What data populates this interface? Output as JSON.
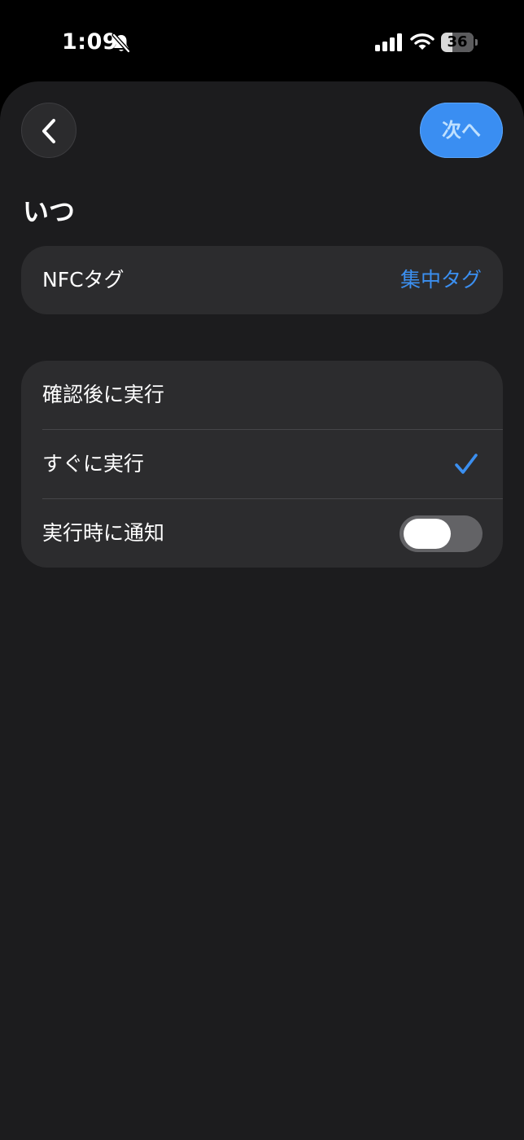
{
  "status_bar": {
    "time": "1:09",
    "battery_level": "36",
    "battery_fraction": 0.36,
    "icons": [
      "bell-slash-icon",
      "cellular-signal-icon",
      "wifi-icon",
      "battery-icon"
    ]
  },
  "header": {
    "back_icon": "chevron-left-icon",
    "next_label": "次へ"
  },
  "section": {
    "title": "いつ"
  },
  "trigger": {
    "label": "NFCタグ",
    "value": "集中タグ"
  },
  "options": {
    "items": [
      {
        "label": "確認後に実行",
        "selected": false
      },
      {
        "label": "すぐに実行",
        "selected": true
      },
      {
        "label": "実行時に通知",
        "toggle": false
      }
    ]
  },
  "colors": {
    "accent": "#3b8ff0",
    "sheet_background": "#1c1c1e",
    "group_background": "#2c2c2e",
    "toggle_off": "#636366"
  }
}
